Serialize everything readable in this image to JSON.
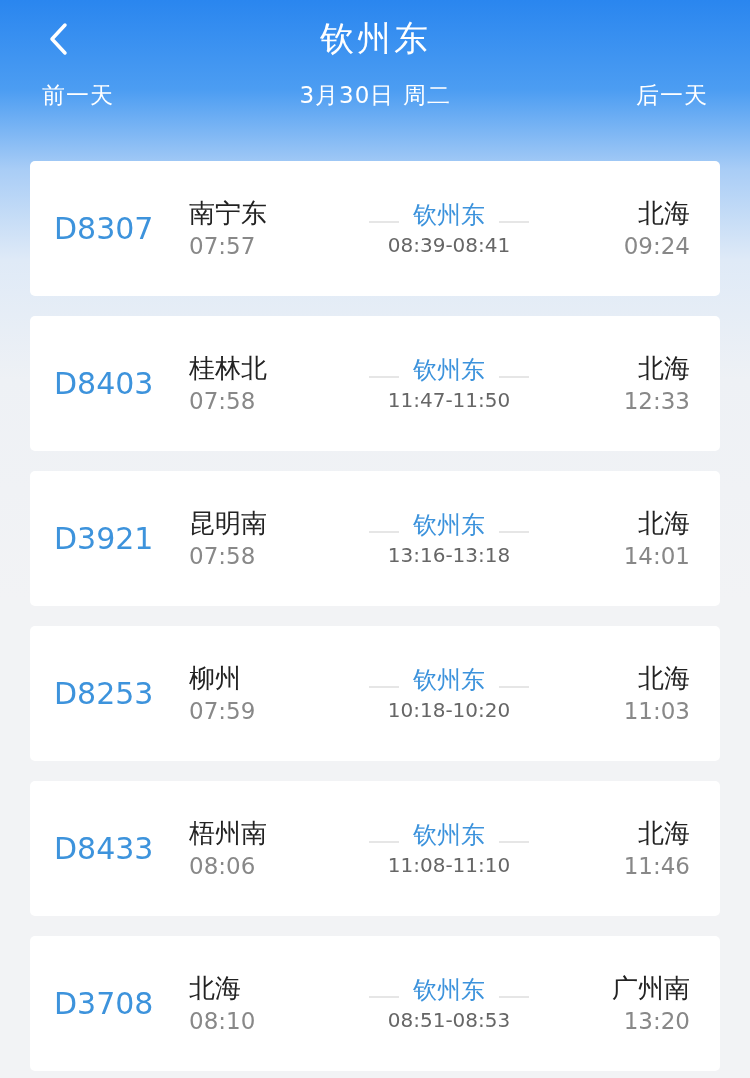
{
  "header": {
    "title": "钦州东",
    "prev_day": "前一天",
    "date": "3月30日 周二",
    "next_day": "后一天"
  },
  "trains": [
    {
      "number": "D8307",
      "from_station": "南宁东",
      "from_time": "07:57",
      "station": "钦州东",
      "stop_time": "08:39-08:41",
      "to_station": "北海",
      "to_time": "09:24"
    },
    {
      "number": "D8403",
      "from_station": "桂林北",
      "from_time": "07:58",
      "station": "钦州东",
      "stop_time": "11:47-11:50",
      "to_station": "北海",
      "to_time": "12:33"
    },
    {
      "number": "D3921",
      "from_station": "昆明南",
      "from_time": "07:58",
      "station": "钦州东",
      "stop_time": "13:16-13:18",
      "to_station": "北海",
      "to_time": "14:01"
    },
    {
      "number": "D8253",
      "from_station": "柳州",
      "from_time": "07:59",
      "station": "钦州东",
      "stop_time": "10:18-10:20",
      "to_station": "北海",
      "to_time": "11:03"
    },
    {
      "number": "D8433",
      "from_station": "梧州南",
      "from_time": "08:06",
      "station": "钦州东",
      "stop_time": "11:08-11:10",
      "to_station": "北海",
      "to_time": "11:46"
    },
    {
      "number": "D3708",
      "from_station": "北海",
      "from_time": "08:10",
      "station": "钦州东",
      "stop_time": "08:51-08:53",
      "to_station": "广州南",
      "to_time": "13:20"
    }
  ]
}
